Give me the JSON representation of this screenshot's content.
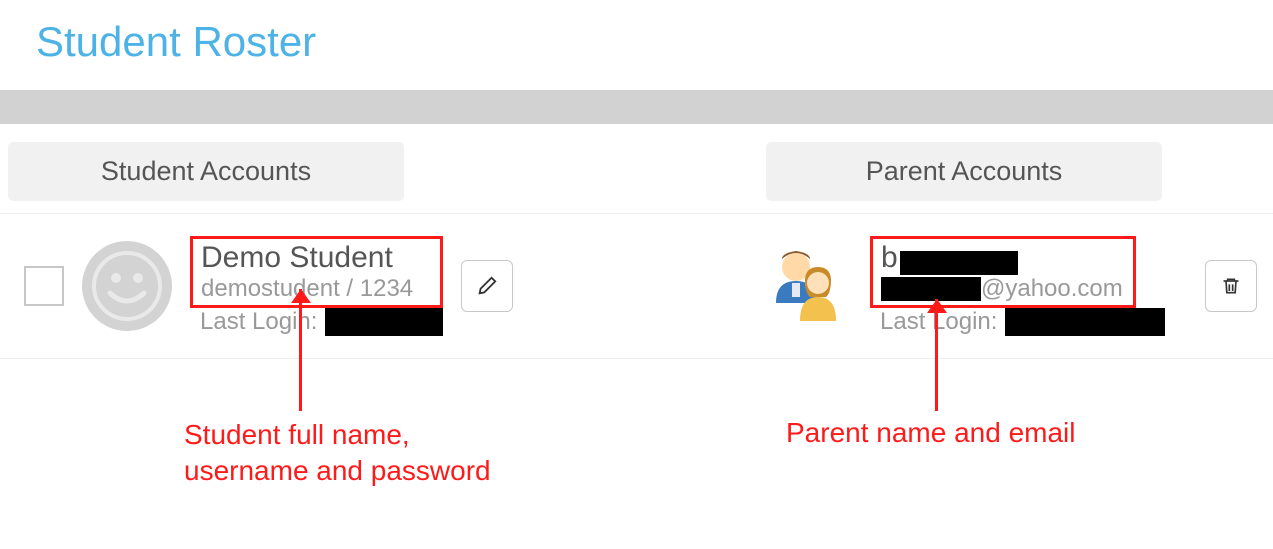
{
  "page_title": "Student Roster",
  "headers": {
    "student": "Student Accounts",
    "parent": "Parent Accounts"
  },
  "student": {
    "name": "Demo Student",
    "credentials": "demostudent / 1234",
    "last_login_label": "Last Login:"
  },
  "parent": {
    "name_prefix": "b",
    "email_suffix": "@yahoo.com",
    "last_login_label": "Last Login:"
  },
  "annotations": {
    "student": "Student full name,\nusername and password",
    "parent": "Parent name and email"
  }
}
